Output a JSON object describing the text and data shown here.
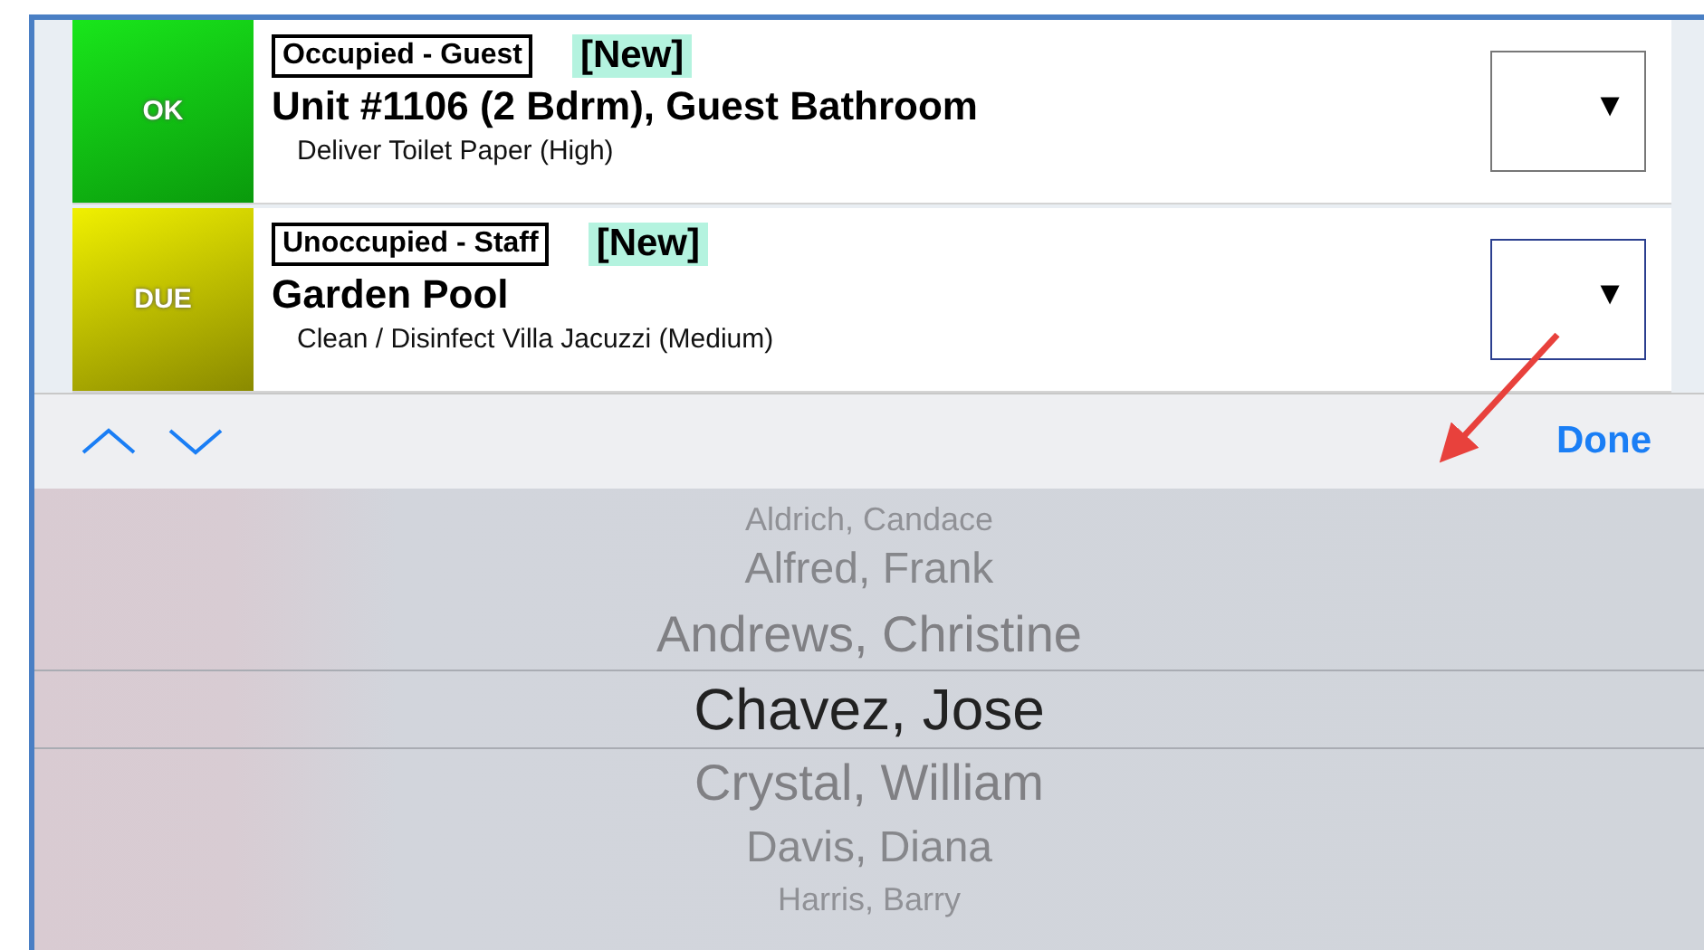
{
  "tasks": [
    {
      "status": {
        "kind": "ok",
        "label": "OK"
      },
      "tag": "Occupied - Guest",
      "badge": "[New]",
      "title": "Unit #1106 (2 Bdrm), Guest Bathroom",
      "detail": "Deliver Toilet Paper (High)",
      "dropdown": {
        "symbol": "▼",
        "focused": false
      }
    },
    {
      "status": {
        "kind": "due",
        "label": "DUE"
      },
      "tag": "Unoccupied - Staff",
      "badge": "[New]",
      "title": "Garden Pool",
      "detail": "Clean / Disinfect Villa Jacuzzi (Medium)",
      "dropdown": {
        "symbol": "▼",
        "focused": true
      }
    }
  ],
  "toolbar": {
    "done": "Done"
  },
  "picker": {
    "items": [
      {
        "label": "Aldrich, Candace",
        "selected": false
      },
      {
        "label": "Alfred, Frank",
        "selected": false
      },
      {
        "label": "Andrews, Christine",
        "selected": false
      },
      {
        "label": "Chavez, Jose",
        "selected": true
      },
      {
        "label": "Crystal, William",
        "selected": false
      },
      {
        "label": "Davis, Diana",
        "selected": false
      },
      {
        "label": "Harris, Barry",
        "selected": false
      }
    ]
  }
}
